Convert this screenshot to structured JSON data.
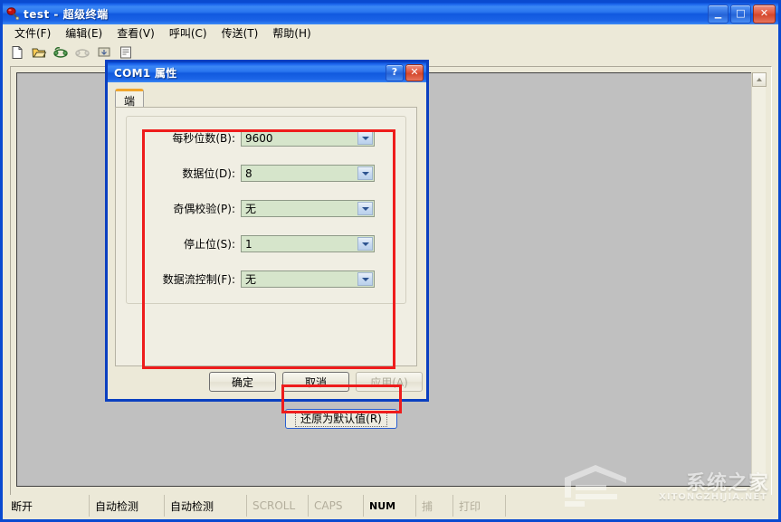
{
  "window": {
    "title": "test - 超级终端",
    "icon": "hyperterminal-icon",
    "controls": {
      "minimize": "_",
      "maximize": "□",
      "close": "✕"
    }
  },
  "menubar": {
    "items": [
      {
        "label": "文件(F)",
        "name": "menu-file"
      },
      {
        "label": "编辑(E)",
        "name": "menu-edit"
      },
      {
        "label": "查看(V)",
        "name": "menu-view"
      },
      {
        "label": "呼叫(C)",
        "name": "menu-call"
      },
      {
        "label": "传送(T)",
        "name": "menu-transfer"
      },
      {
        "label": "帮助(H)",
        "name": "menu-help"
      }
    ]
  },
  "toolbar": {
    "items": [
      {
        "icon": "new-document-icon",
        "enabled": true
      },
      {
        "icon": "open-folder-icon",
        "enabled": true
      },
      {
        "icon": "phone-call-icon",
        "enabled": true
      },
      {
        "icon": "phone-hangup-icon",
        "enabled": false
      },
      {
        "icon": "transfer-icon",
        "enabled": true
      },
      {
        "icon": "properties-icon",
        "enabled": true
      }
    ]
  },
  "statusbar": {
    "cells": [
      {
        "label": "断开",
        "dim": false,
        "name": "status-connection"
      },
      {
        "label": "自动检测",
        "dim": false,
        "name": "status-autodetect-1"
      },
      {
        "label": "自动检测",
        "dim": false,
        "name": "status-autodetect-2"
      },
      {
        "label": "SCROLL",
        "dim": true,
        "name": "status-scroll"
      },
      {
        "label": "CAPS",
        "dim": true,
        "name": "status-caps"
      },
      {
        "label": "NUM",
        "dim": false,
        "name": "status-num"
      },
      {
        "label": "捕",
        "dim": true,
        "name": "status-capture"
      },
      {
        "label": "打印",
        "dim": true,
        "name": "status-print"
      }
    ]
  },
  "dialog": {
    "title": "COM1 属性",
    "help_button": "?",
    "close_button": "✕",
    "tab": "端口设置",
    "fields": [
      {
        "label": "每秒位数(B):",
        "value": "9600",
        "name": "bits-per-second"
      },
      {
        "label": "数据位(D):",
        "value": "8",
        "name": "data-bits"
      },
      {
        "label": "奇偶校验(P):",
        "value": "无",
        "name": "parity"
      },
      {
        "label": "停止位(S):",
        "value": "1",
        "name": "stop-bits"
      },
      {
        "label": "数据流控制(F):",
        "value": "无",
        "name": "flow-control"
      }
    ],
    "restore_defaults": "还原为默认值(R)",
    "buttons": [
      {
        "label": "确定",
        "name": "ok-button",
        "enabled": true
      },
      {
        "label": "取消",
        "name": "cancel-button",
        "enabled": true
      },
      {
        "label": "应用(A)",
        "name": "apply-button",
        "enabled": false
      }
    ]
  },
  "watermark": {
    "text": "系统之家",
    "subtext": "XITONGZHIJIA.NET"
  },
  "colors": {
    "titlebar_blue": "#1e68ee",
    "annotation_red": "#ee1c1c",
    "combo_green": "#d6e5cb",
    "tab_orange": "#f0a62c",
    "terminal_gray": "#c0c0c0"
  }
}
